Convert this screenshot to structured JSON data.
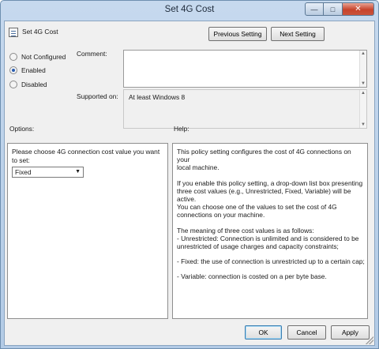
{
  "window": {
    "title": "Set 4G Cost",
    "minimize_icon": "minimize-icon",
    "maximize_icon": "maximize-icon",
    "close_icon": "close-icon"
  },
  "header": {
    "title": "Set 4G Cost",
    "icon": "policy-setting-icon",
    "previous_label": "Previous Setting",
    "next_label": "Next Setting"
  },
  "state": {
    "options": [
      {
        "label": "Not Configured",
        "selected": false
      },
      {
        "label": "Enabled",
        "selected": true
      },
      {
        "label": "Disabled",
        "selected": false
      }
    ]
  },
  "comment": {
    "label": "Comment:",
    "value": ""
  },
  "supported": {
    "label": "Supported on:",
    "value": "At least Windows 8"
  },
  "options_panel": {
    "heading": "Options:",
    "prompt": "Please choose 4G connection cost value you want to set:",
    "dropdown_value": "Fixed"
  },
  "help_panel": {
    "heading": "Help:",
    "paragraphs": [
      [
        "This policy setting configures the cost of 4G connections on your",
        "local machine."
      ],
      [
        "If you enable this policy setting, a drop-down list box presenting",
        "three cost values (e.g., Unrestricted, Fixed, Variable) will be active.",
        "You can choose one of the values to set the cost of 4G",
        "connections on your machine."
      ],
      [
        "The meaning of three cost values is as follows:",
        "- Unrestricted: Connection is unlimited and is considered to be",
        "unrestricted of usage charges and capacity constraints;"
      ],
      [
        "- Fixed: the use of connection is unrestricted up to a certain cap;"
      ],
      [
        "- Variable: connection is costed on a per byte base."
      ]
    ]
  },
  "footer": {
    "ok_label": "OK",
    "cancel_label": "Cancel",
    "apply_label": "Apply"
  }
}
